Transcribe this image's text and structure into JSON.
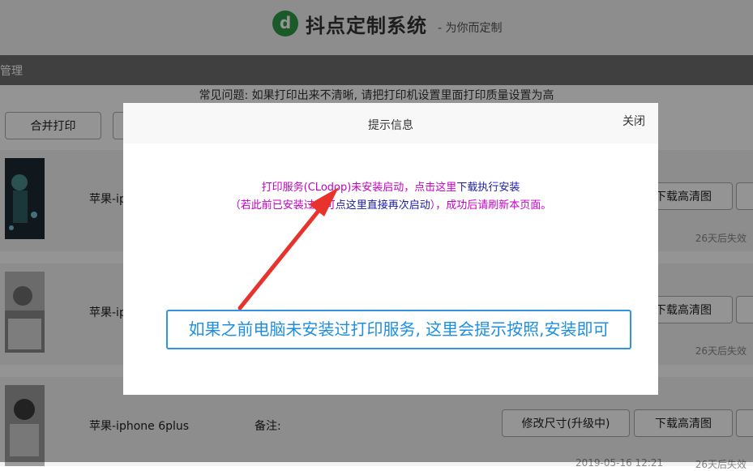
{
  "header": {
    "logo_letter": "d",
    "brand": "抖点定制系统",
    "tagline": "- 为你而定制"
  },
  "nav": {
    "label": "管理"
  },
  "notice": "常见问题: 如果打印出来不清晰, 请把打印机设置里面打印质量设置为高",
  "toolbar": {
    "merge_print": "合并打印"
  },
  "products": [
    {
      "name": "苹果-ip",
      "download": "下载高清图",
      "expire": "26天后失效"
    },
    {
      "name": "苹果-ip",
      "download": "下载高清图",
      "expire": "26天后失效"
    },
    {
      "name": "苹果-iphone 6plus",
      "remark": "备注:",
      "modify": "修改尺寸(升级中)",
      "download": "下载高清图",
      "date": "2019-05-16 12:21",
      "expire": "26天后失效"
    }
  ],
  "modal": {
    "title": "提示信息",
    "close": "关闭",
    "line1_prefix": "打印服务(CLodop)未安装启动，点击这里",
    "line1_link": "下载执行安装",
    "line2_prefix": "（若此前已安装过，可",
    "line2_link": "点这里直接再次启动",
    "line2_suffix": "），成功后请刷新本页面。"
  },
  "annotation": "如果之前电脑未安装过打印服务, 这里会提示按照,安装即可",
  "colors": {
    "brand_green": "#2e9b48",
    "message_magenta": "#c700c7",
    "link_blue": "#1a1aa8",
    "callout_blue": "#2f95e0",
    "arrow_red": "#e8322c"
  }
}
